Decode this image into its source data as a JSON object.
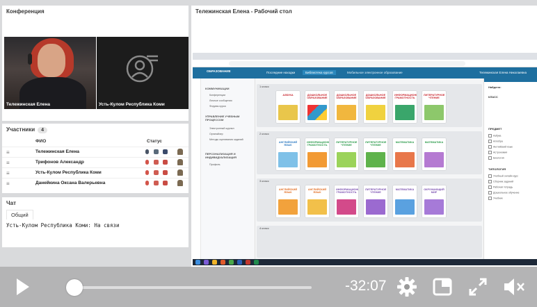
{
  "conference": {
    "title": "Конференция",
    "video1_name": "Тележинская Елена",
    "video2_name": "Усть-Кулом Республика Коми"
  },
  "participants": {
    "title": "Участники",
    "count": "4",
    "col_name": "ФИО",
    "col_status": "Статус",
    "rows": [
      {
        "name": "Тележинская Елена"
      },
      {
        "name": "Трифонов Александр"
      },
      {
        "name": "Усть-Кулом Республика Коми"
      },
      {
        "name": "Данейкина Оксана  Валерьевна"
      }
    ]
  },
  "chat": {
    "title": "Чат",
    "tab": "Общий",
    "message": "Усть-Кулом Республика Коми: На связи"
  },
  "desktop": {
    "title": "Тележинская Елена - Рабочий стол",
    "app": {
      "logo": "ОБРАЗОВАНИЕ",
      "tab1": "Последние находки",
      "tab2": "Библиотека курсов",
      "center": "Мобильное электронное образование",
      "user": "Тележинская Елена Николаевна",
      "nav": [
        "КОММУНИКАЦИИ",
        "Конференции",
        "Личные сообщения",
        "Форумы курса",
        "УПРАВЛЕНИЕ УЧЕБНЫМ ПРОЦЕССОМ",
        "Электронный журнал",
        "Органайзер",
        "Методы оценивания заданий",
        "ПЕРСОНАЛИЗАЦИЯ И ИНДИВИДУАЛИЗАЦИЯ",
        "Профиль"
      ],
      "rows": [
        "1 класс",
        "2 класс",
        "3 класс",
        "4 класс"
      ],
      "books_row1": [
        "АЗБУКА",
        "ДОШКОЛЬНОЕ ОБРАЗОВАНИЕ",
        "ДОШКОЛЬНОЕ ОБРАЗОВАНИЕ",
        "ДОШКОЛЬНОЕ ОБРАЗОВАНИЕ",
        "ИНФОРМАЦИОННАЯ ГРАМОТНОСТЬ",
        "ЛИТЕРАТУРНОЕ ЧТЕНИЕ"
      ],
      "books_row2": [
        "АНГЛИЙСКИЙ ЯЗЫК",
        "ИНФОРМАЦИОННАЯ ГРАМОТНОСТЬ",
        "ЛИТЕРАТУРНОЕ ЧТЕНИЕ",
        "ЛИТЕРАТУРНОЕ ЧТЕНИЕ",
        "МАТЕМАТИКА",
        "МАТЕМАТИКА"
      ],
      "books_row3": [
        "АНГЛИЙСКИЙ ЯЗЫК",
        "АНГЛИЙСКИЙ ЯЗЫК",
        "ИНФОРМАЦИОННАЯ ГРАМОТНОСТЬ",
        "ЛИТЕРАТУРНОЕ ЧТЕНИЕ",
        "МАТЕМАТИКА",
        "ОКРУЖАЮЩИЙ МИР"
      ],
      "filter_found": "Найдено:",
      "filter_class": "КЛАСС",
      "filter_subject": "ПРЕДМЕТ",
      "filter_type": "ТИПОЛОГИЯ",
      "subjects": [
        "Азбука",
        "Алгебра",
        "Английский язык",
        "Астрономия",
        "Биология"
      ],
      "types": [
        "Учебный онлайн курс",
        "Сборник заданий",
        "Рабочая тетрадь",
        "Дошкольное обучение",
        "Учебник"
      ]
    }
  },
  "player": {
    "time": "-32:07",
    "progress": 0.01
  }
}
